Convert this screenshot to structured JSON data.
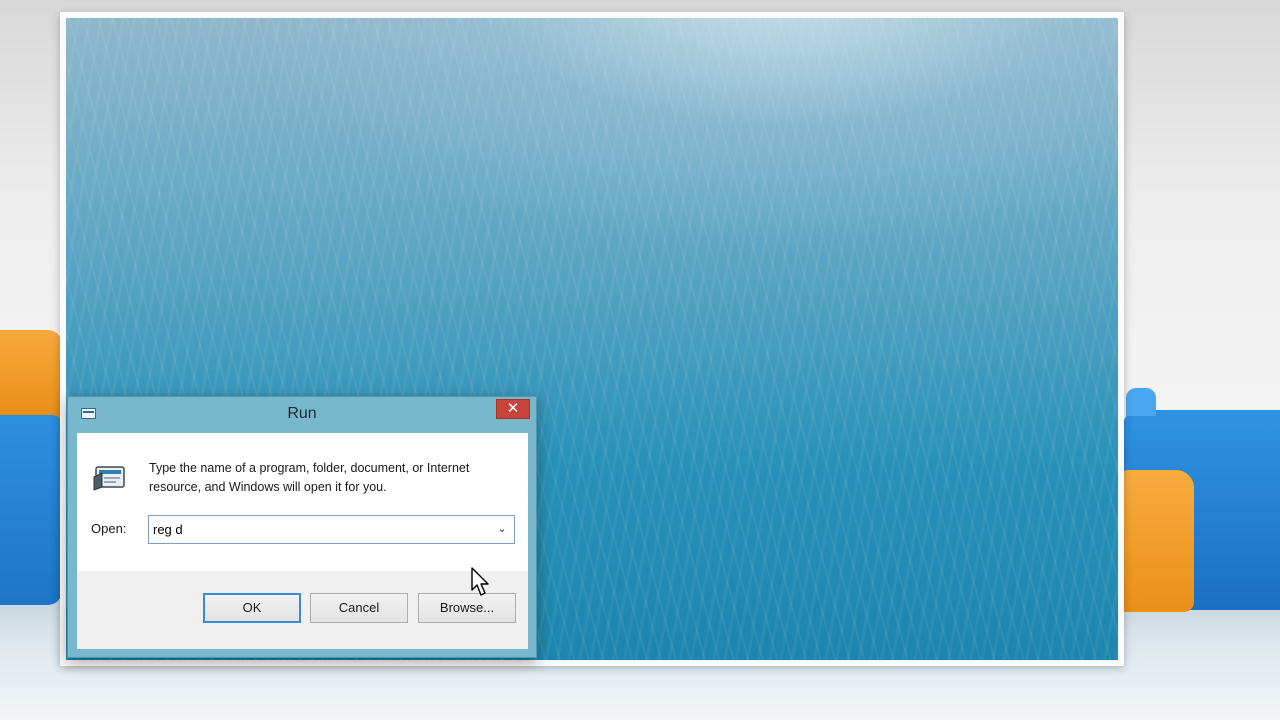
{
  "run_dialog": {
    "title": "Run",
    "description": "Type the name of a program, folder, document, or Internet resource, and Windows will open it for you.",
    "open_label": "Open:",
    "open_value": "reg d",
    "buttons": {
      "ok": "OK",
      "cancel": "Cancel",
      "browse": "Browse..."
    },
    "close_glyph": "✕"
  },
  "icons": {
    "title": "run-small-icon",
    "run": "run-program-icon",
    "close": "close-icon",
    "dropdown": "chevron-down-icon",
    "cursor": "mouse-pointer-icon"
  },
  "colors": {
    "dialog_frame": "#79b8cc",
    "close_button": "#c7453a",
    "desktop": "#2791b8"
  }
}
